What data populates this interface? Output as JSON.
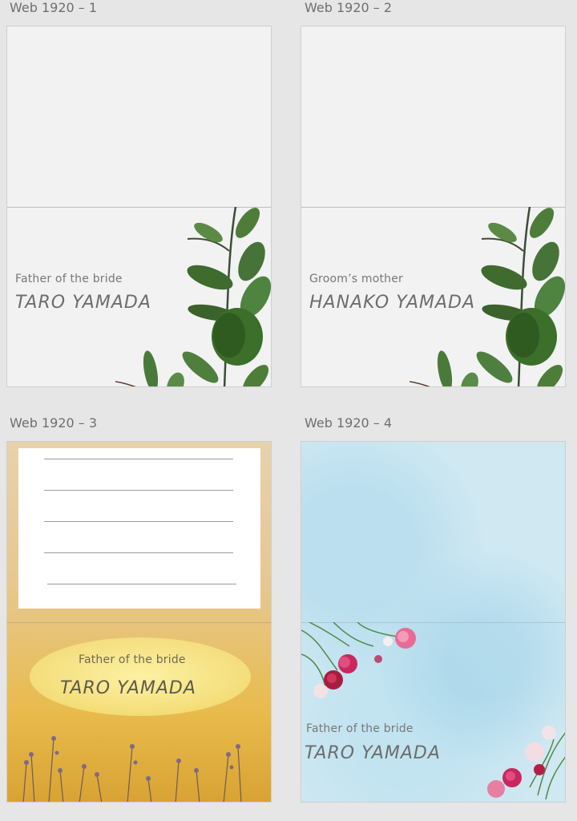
{
  "artboards": [
    {
      "title": "Web 1920 – 1",
      "label": "Father of the bride",
      "name": "TARO YAMADA"
    },
    {
      "title": "Web 1920 – 2",
      "label": "Groom’s mother",
      "name": "HANAKO YAMADA"
    },
    {
      "title": "Web 1920 – 3",
      "label": "Father of the bride",
      "name": "TARO YAMADA"
    },
    {
      "title": "Web 1920 – 4",
      "label": "Father of the bride",
      "name": "TARO YAMADA"
    }
  ],
  "colors": {
    "canvas": "#e6e6e6",
    "leaf_green": "#3f6b2e",
    "mustard": "#e8bb4c",
    "sky": "#cfe8f2",
    "rose": "#c8285e"
  }
}
